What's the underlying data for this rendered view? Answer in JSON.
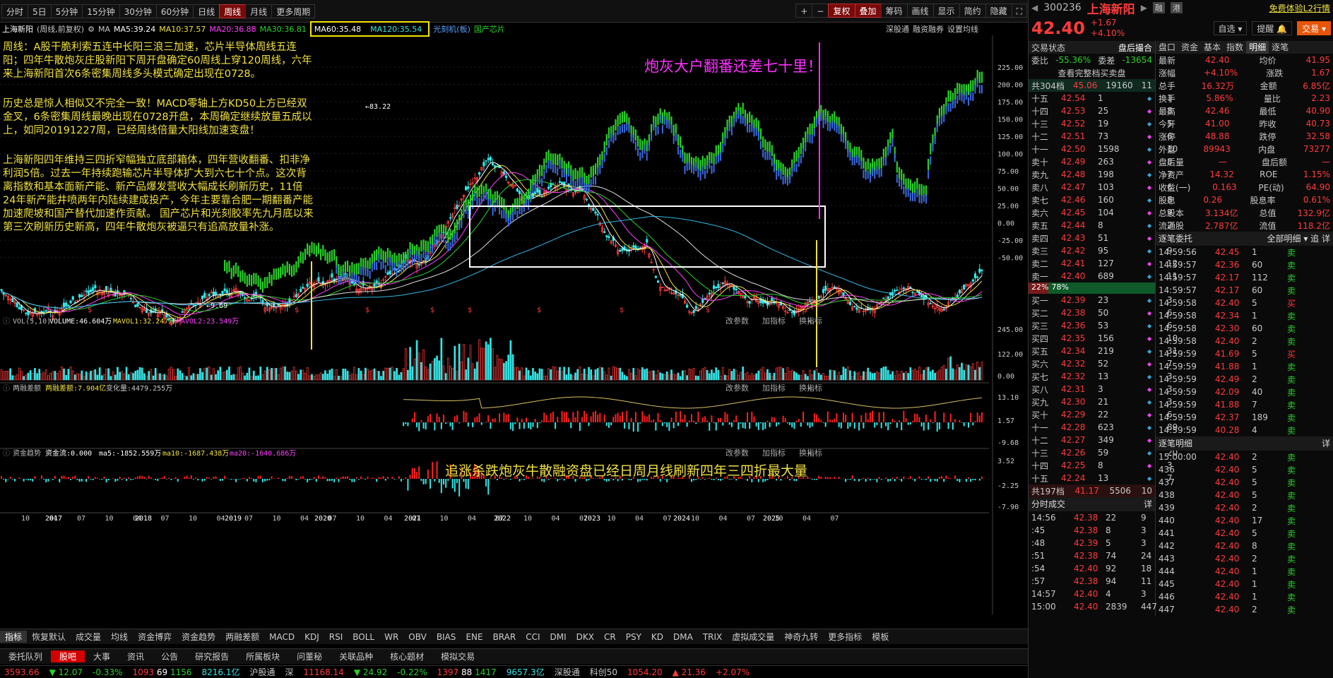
{
  "toolbar": {
    "periods": [
      "分时",
      "5日",
      "5分钟",
      "15分钟",
      "30分钟",
      "60分钟",
      "日线",
      "周线",
      "月线",
      "更多周期"
    ],
    "active_period": "周线",
    "right": [
      "复权",
      "叠加",
      "筹码",
      "画线",
      "显示",
      "简约",
      "隐藏"
    ]
  },
  "legend": {
    "stock": "上海新阳",
    "mode": "(周线,前复权)",
    "ma_label": "MA",
    "ma5": "MA5:39.24",
    "ma10": "MA10:37.57",
    "ma20": "MA20:36.88",
    "ma30": "MA30:36.81",
    "ma60": "MA60:35.48",
    "ma120": "MA120:35.54",
    "overlay1": "光刻机(板)",
    "overlay2": "国产芯片",
    "links": [
      "深股通",
      "融资融券",
      "设置均线"
    ]
  },
  "annotations": {
    "p1": "周线：A股干脆利索五连中长阳三浪三加速，芯片半导体周线五连阳；四年牛散炮灰庄股新阳下周开盘确定60周线上穿120周线，六年来上海新阳首次6条密集周线多头模式确定出现在0728。",
    "p2": "历史总是惊人相似又不完全一致！MACD零轴上方KD50上方已经双金叉，6条密集周线最晚出现在0728开盘，本周确定继续放量五成以上，如同20191227周，已经周线倍量大阳线加速变盘！",
    "p3": "上海新阳四年维持三四折窄幅独立底部箱体，四年营收翻番、扣非净利润5倍。过去一年持续跑输芯片半导体扩大到六七十个点。这次背离指数和基本面新产能、新产品爆发营收大幅成长刷新历史，11倍24年新产能井喷两年内陆续建成投产，今年主要靠合肥一期翻番产能加速爬坡和国产替代加速作贡献。 国产芯片和光刻胶率先九月底以来第三次刷新历史新高，四年牛散炮灰被逼只有追高放量补涨。",
    "headline": "炮灰大户翻番还差七十里！",
    "margin_note": "追涨杀跌炮灰牛散融资盘已经日周月线刷新四年三四折最大量",
    "high_label": "83.22",
    "low_label": "9.69"
  },
  "axis": {
    "price_right": [
      "225.00",
      "200.00",
      "175.00",
      "150.00",
      "125.00",
      "100.00",
      "75.00",
      "50.00",
      "25.00",
      "0.00",
      "-25.00",
      "-50.00"
    ],
    "vol_right": [
      "245.00",
      "122.00",
      "0.00"
    ],
    "margin_right": [
      "13.10",
      "1.57",
      "-9.68"
    ],
    "flow_right": [
      "3.52",
      "-2.25",
      "-7.90"
    ],
    "years": [
      "2017",
      "2018",
      "2019",
      "2020",
      "2021",
      "2022",
      "2023",
      "2024",
      "2025"
    ],
    "months": [
      "10",
      "04",
      "07",
      "10",
      "04",
      "07",
      "10",
      "04",
      "07",
      "10",
      "04",
      "07",
      "10",
      "04",
      "07",
      "10",
      "04",
      "07",
      "10",
      "04",
      "07",
      "10",
      "04",
      "07",
      "10",
      "04",
      "07",
      "10",
      "04",
      "07"
    ]
  },
  "panels": {
    "vol": {
      "name": "VOL(5,10)",
      "v1": "VOLUME:46.604万",
      "v2": "MAVOL1:32.247万",
      "v3": "MAVOL2:23.549万"
    },
    "margin": {
      "name": "两融差额",
      "v1": "两融差额:7.904亿",
      "v2": "变化量:4479.255万"
    },
    "flow": {
      "name": "资金趋势",
      "v1": "资金流:0.000",
      "v2": "ma5:-1852.559万",
      "v3": "ma10:-1687.438万",
      "v4": "ma20:-1640.686万"
    },
    "tools": [
      "改参数",
      "加指标",
      "换指标"
    ]
  },
  "indicator_tabs": [
    "指标",
    "恢复默认",
    "成交量",
    "均线",
    "资金博弈",
    "资金趋势",
    "两融差额",
    "MACD",
    "KDJ",
    "RSI",
    "BOLL",
    "WR",
    "OBV",
    "BIAS",
    "ENE",
    "BRAR",
    "CCI",
    "DMI",
    "DKX",
    "CR",
    "PSY",
    "KD",
    "DMA",
    "TRIX",
    "虚拟成交量",
    "神奇九转",
    "更多指标",
    "模板"
  ],
  "bottom_nav": [
    "委托队列",
    "股吧",
    "大事",
    "资讯",
    "公告",
    "研究报告",
    "所属板块",
    "问董秘",
    "关联品种",
    "核心题材",
    "模拟交易"
  ],
  "quote": {
    "code": "300236",
    "name": "上海新阳",
    "price": "42.40",
    "change": "+1.67",
    "pct": "+4.10%",
    "free_trial": "免费体验L2行情",
    "zixuan": "自选",
    "tixing": "提醒",
    "jiaoyi": "交易",
    "state": "交易状态",
    "state_val": "盘后撮合",
    "weibi": "-55.36%",
    "weicha": "-13654",
    "full_book": "查看完整档买卖盘",
    "sell_total_label": "共304档",
    "sell_total_price": "45.06",
    "sell_total_vol": "19160",
    "sell_total_n": "11",
    "ratio_l": "22%",
    "ratio_r": "78%",
    "buy_total_label": "共197档",
    "buy_total_price": "41.17",
    "buy_total_vol": "5506",
    "buy_total_n": "10"
  },
  "sells": [
    [
      "十五",
      "42.54",
      "1",
      "1"
    ],
    [
      "十四",
      "42.53",
      "25",
      "8"
    ],
    [
      "十三",
      "42.52",
      "19",
      "5"
    ],
    [
      "十二",
      "42.51",
      "73",
      "6"
    ],
    [
      "十一",
      "42.50",
      "1598",
      "10"
    ],
    [
      "卖十",
      "42.49",
      "263",
      "8"
    ],
    [
      "卖九",
      "42.48",
      "198",
      "7"
    ],
    [
      "卖八",
      "42.47",
      "103",
      "6"
    ],
    [
      "卖七",
      "42.46",
      "160",
      "8"
    ],
    [
      "卖六",
      "42.45",
      "104",
      "9"
    ],
    [
      "卖五",
      "42.44",
      "8",
      "2"
    ],
    [
      "卖四",
      "42.43",
      "51",
      "7"
    ],
    [
      "卖三",
      "42.42",
      "95",
      "9"
    ],
    [
      "卖二",
      "42.41",
      "127",
      "12"
    ],
    [
      "卖一",
      "42.40",
      "689",
      "11"
    ]
  ],
  "buys": [
    [
      "买一",
      "42.39",
      "23",
      "3"
    ],
    [
      "买二",
      "42.38",
      "50",
      "6"
    ],
    [
      "买三",
      "42.36",
      "53",
      "6"
    ],
    [
      "买四",
      "42.35",
      "156",
      "10"
    ],
    [
      "买五",
      "42.34",
      "219",
      "31"
    ],
    [
      "买六",
      "42.32",
      "52",
      "7"
    ],
    [
      "买七",
      "42.32",
      "13",
      "3"
    ],
    [
      "买八",
      "42.31",
      "3",
      "3"
    ],
    [
      "买九",
      "42.30",
      "21",
      "3"
    ],
    [
      "买十",
      "42.29",
      "22",
      "6"
    ],
    [
      "十一",
      "42.28",
      "623",
      "89"
    ],
    [
      "十二",
      "42.27",
      "349",
      "175"
    ],
    [
      "十三",
      "42.26",
      "59",
      "20"
    ],
    [
      "十四",
      "42.25",
      "8",
      "3"
    ],
    [
      "十五",
      "42.24",
      "13",
      "7"
    ]
  ],
  "stats_tabs": [
    "盘口",
    "资金",
    "基本",
    "指数",
    "明细",
    "逐笔"
  ],
  "stats": [
    [
      "均价",
      "41.95"
    ],
    [
      "涨跌",
      "1.67"
    ],
    [
      "金额",
      "6.85亿"
    ],
    [
      "量比",
      "2.23"
    ],
    [
      "最低",
      "40.90"
    ],
    [
      "昨收",
      "40.73"
    ],
    [
      "跌停",
      "32.58"
    ],
    [
      "内盘",
      "73277"
    ],
    [
      "盘后额",
      "—"
    ],
    [
      "ROE",
      "1.15%"
    ],
    [
      "PE(动)",
      "64.90"
    ],
    [
      "股息率",
      "0.61%"
    ],
    [
      "总值",
      "132.9亿"
    ],
    [
      "流值",
      "118.2亿"
    ]
  ],
  "stats_left": [
    [
      "最新",
      "42.40"
    ],
    [
      "涨幅",
      "+4.10%"
    ],
    [
      "总手",
      "16.32万"
    ],
    [
      "换手",
      "5.86%"
    ],
    [
      "最高",
      "42.46"
    ],
    [
      "今开",
      "41.00"
    ],
    [
      "涨停",
      "48.88"
    ],
    [
      "外盘",
      "89943"
    ],
    [
      "盘后量",
      "—"
    ],
    [
      "净资产",
      "14.32"
    ],
    [
      "收益(一)",
      "0.163"
    ],
    [
      "股息",
      "0.26"
    ],
    [
      "总股本",
      "3.134亿"
    ],
    [
      "流通股",
      "2.787亿"
    ]
  ],
  "zhubi_title": "逐笔委托",
  "zhubi_filter": "全部明细",
  "zhubi": [
    [
      "14:59:56",
      "42.45",
      "1",
      "卖"
    ],
    [
      "14:59:57",
      "42.36",
      "60",
      "卖"
    ],
    [
      "14:59:57",
      "42.17",
      "112",
      "卖"
    ],
    [
      "14:59:57",
      "42.17",
      "60",
      "卖"
    ],
    [
      "14:59:58",
      "42.40",
      "5",
      "买"
    ],
    [
      "14:59:58",
      "42.34",
      "1",
      "卖"
    ],
    [
      "14:59:58",
      "42.30",
      "60",
      "卖"
    ],
    [
      "14:59:58",
      "42.40",
      "2",
      "卖"
    ],
    [
      "14:59:59",
      "41.69",
      "5",
      "买"
    ],
    [
      "14:59:59",
      "41.88",
      "1",
      "卖"
    ],
    [
      "14:59:59",
      "42.49",
      "2",
      "卖"
    ],
    [
      "14:59:59",
      "42.09",
      "40",
      "卖"
    ],
    [
      "14:59:59",
      "41.88",
      "7",
      "卖"
    ],
    [
      "14:59:59",
      "42.37",
      "189",
      "卖"
    ],
    [
      "14:59:59",
      "40.28",
      "4",
      "卖"
    ]
  ],
  "mingxi_title": "逐笔明细",
  "mingxi": [
    [
      "15:00:00",
      "42.40",
      "2",
      "卖"
    ],
    [
      "436",
      "42.40",
      "5",
      "卖"
    ],
    [
      "437",
      "42.40",
      "5",
      "卖"
    ],
    [
      "438",
      "42.40",
      "5",
      "卖"
    ],
    [
      "439",
      "42.40",
      "2",
      "卖"
    ],
    [
      "440",
      "42.40",
      "17",
      "卖"
    ],
    [
      "441",
      "42.40",
      "5",
      "卖"
    ],
    [
      "442",
      "42.40",
      "8",
      "卖"
    ],
    [
      "443",
      "42.40",
      "2",
      "卖"
    ],
    [
      "444",
      "42.40",
      "1",
      "卖"
    ],
    [
      "445",
      "42.40",
      "1",
      "卖"
    ],
    [
      "446",
      "42.40",
      "1",
      "卖"
    ],
    [
      "447",
      "42.40",
      "2",
      "卖"
    ]
  ],
  "fenshi_title": "分时成交",
  "fenshi": [
    [
      "14:56",
      "42.38",
      "22",
      "9"
    ],
    [
      ":45",
      "42.38",
      "8",
      "3"
    ],
    [
      ":48",
      "42.39",
      "5",
      "3"
    ],
    [
      ":51",
      "42.38",
      "74",
      "24"
    ],
    [
      ":54",
      "42.40",
      "92",
      "18"
    ],
    [
      ":57",
      "42.38",
      "94",
      "11"
    ],
    [
      "14:57",
      "42.40",
      "4",
      "3"
    ],
    [
      "15:00",
      "42.40",
      "2839",
      "447"
    ]
  ],
  "status": {
    "sh": "3593.66",
    "sh_chg": "▼ 12.07",
    "sh_pct": "-0.33%",
    "sh_up": "1093",
    "sh_flat": "69",
    "sh_down": "1156",
    "sh_amt": "8216.1亿",
    "hgt": "沪股通",
    "sz": "深",
    "sz_val": "11168.14",
    "sz_chg": "▼ 24.92",
    "sz_pct": "-0.22%",
    "sz_up": "1397",
    "sz_flat": "88",
    "sz_down": "1417",
    "sz_amt": "9657.3亿",
    "sgt": "深股通",
    "kc": "科创50",
    "kc_val": "1054.20",
    "kc_chg": "▲ 21.36",
    "kc_pct": "+2.07%"
  }
}
